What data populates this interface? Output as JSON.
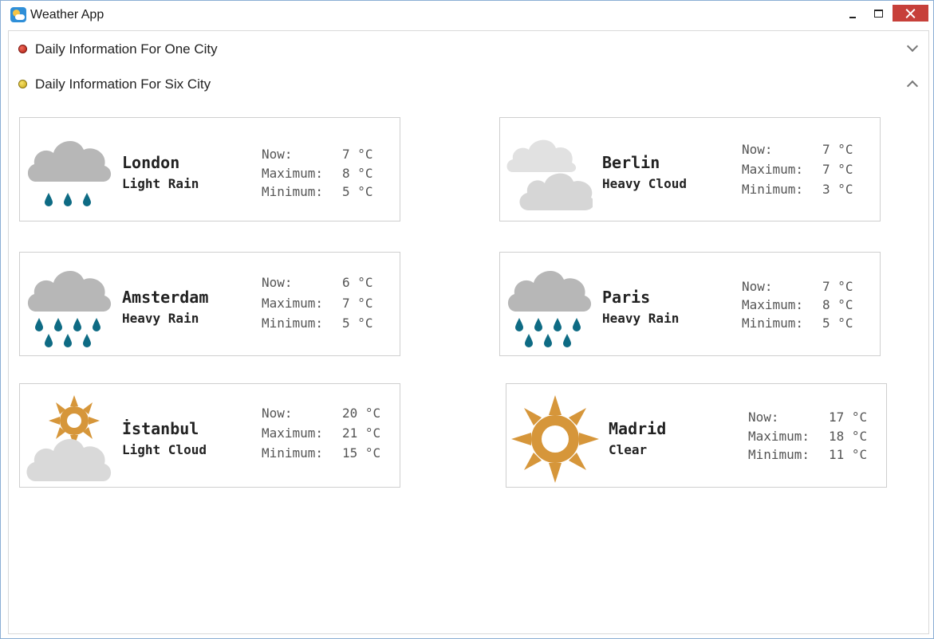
{
  "window": {
    "title": "Weather App"
  },
  "sections": [
    {
      "title": "Daily Information For One City",
      "expanded": false,
      "dot_color": "#c0261b"
    },
    {
      "title": "Daily Information For Six City",
      "expanded": true,
      "dot_color": "#e0c32a"
    }
  ],
  "labels": {
    "now": "Now:",
    "maximum": "Maximum:",
    "minimum": "Minimum:"
  },
  "cities": [
    {
      "name": "London",
      "condition": "Light Rain",
      "icon": "light-rain-icon",
      "now": "7 °C",
      "max": "8 °C",
      "min": "5 °C"
    },
    {
      "name": "Berlin",
      "condition": "Heavy Cloud",
      "icon": "heavy-cloud-icon",
      "now": "7 °C",
      "max": "7 °C",
      "min": "3 °C"
    },
    {
      "name": "Amsterdam",
      "condition": "Heavy Rain",
      "icon": "heavy-rain-icon",
      "now": "6 °C",
      "max": "7 °C",
      "min": "5 °C"
    },
    {
      "name": "Paris",
      "condition": "Heavy Rain",
      "icon": "heavy-rain-icon",
      "now": "7 °C",
      "max": "8 °C",
      "min": "5 °C"
    },
    {
      "name": "İstanbul",
      "condition": "Light Cloud",
      "icon": "light-cloud-icon",
      "now": "20 °C",
      "max": "21 °C",
      "min": "15 °C"
    },
    {
      "name": "Madrid",
      "condition": "Clear",
      "icon": "clear-sun-icon",
      "now": "17 °C",
      "max": "18 °C",
      "min": "11 °C"
    }
  ],
  "colors": {
    "rain_drop": "#0e6b84",
    "cloud_dark": "#b7b7b7",
    "cloud_light": "#d9d9d9",
    "sun": "#d6963a",
    "close_button": "#c7403a"
  }
}
